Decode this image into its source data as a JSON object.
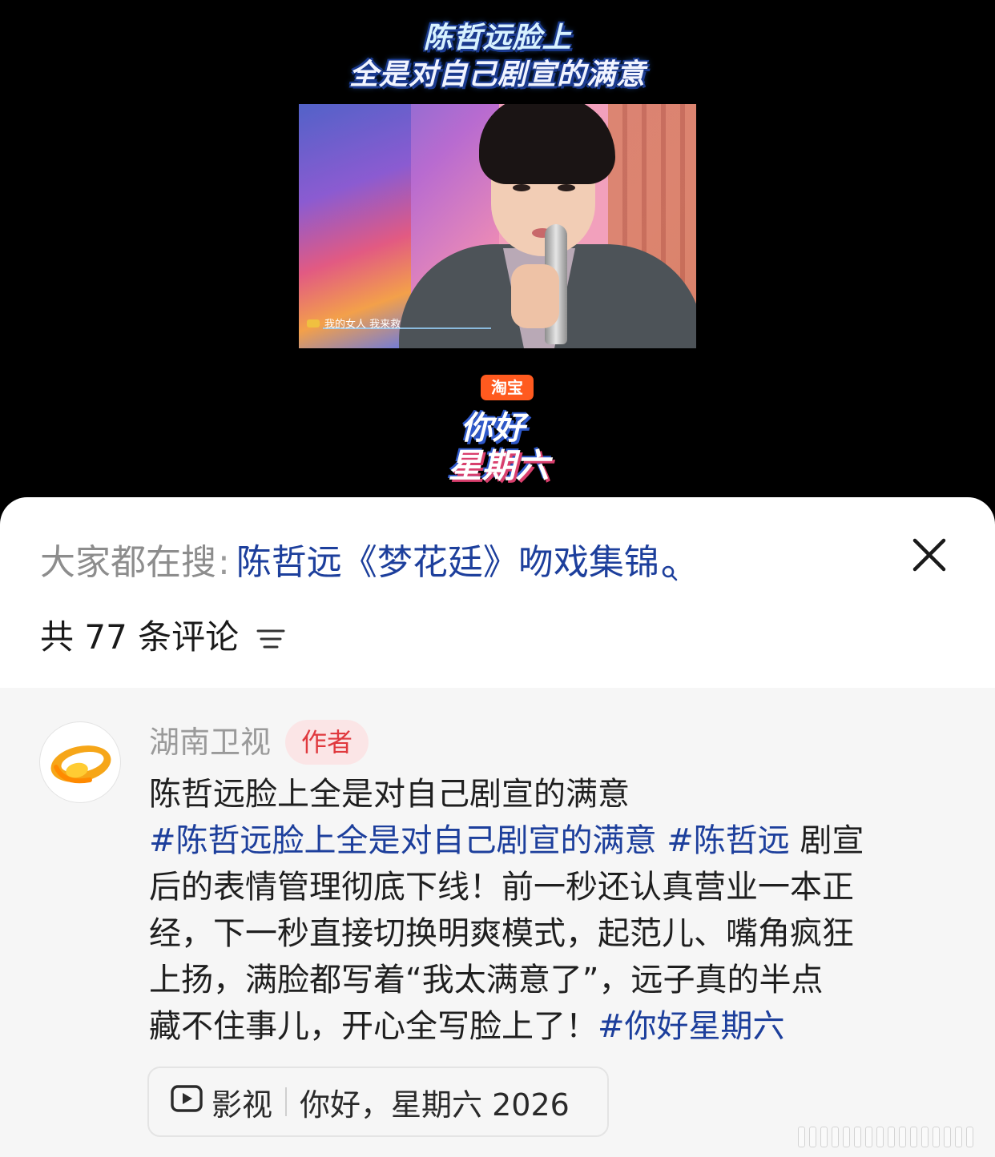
{
  "video": {
    "title_line1": "陈哲远脸上",
    "title_line2": "全是对自己剧宣的满意",
    "subtitle": "我的女人 我来救",
    "logo_badge": "淘宝",
    "logo_line1": "你好",
    "logo_line2": "星期六"
  },
  "search": {
    "prefix": "大家都在搜",
    "separator": ":",
    "query": "陈哲远《梦花廷》吻戏集锦"
  },
  "comments_header": {
    "count_label": "共 77 条评论"
  },
  "comment": {
    "author": "湖南卫视",
    "badge": "作者",
    "line1": "陈哲远脸上全是对自己剧宣的满意",
    "line2_tag1": "#陈哲远脸上全是对自己剧宣的满意",
    "line2_tag2": "#陈哲远",
    "line2_text": " 剧宣",
    "line3": "后的表情管理彻底下线！前一秒还认真营业一本正",
    "line4": "经，下一秒直接切换明爽模式，起范儿、嘴角疯狂",
    "line5": "上扬，满脸都写着“我太满意了”，远子真的半点",
    "line6_text": "藏不住事儿，开心全写脸上了！",
    "line6_tag": "#你好星期六"
  },
  "video_card": {
    "category": "影视",
    "show": "你好，星期六 2026"
  },
  "colors": {
    "link": "#1d3f9c",
    "badge_text": "#e0393e",
    "badge_bg": "#fbe5e6",
    "panel_bg": "#ffffff",
    "comment_bg": "#f6f6f6"
  },
  "icons": {
    "search": "search-icon",
    "close": "close-icon",
    "sort": "sort-icon",
    "play": "play-icon"
  }
}
